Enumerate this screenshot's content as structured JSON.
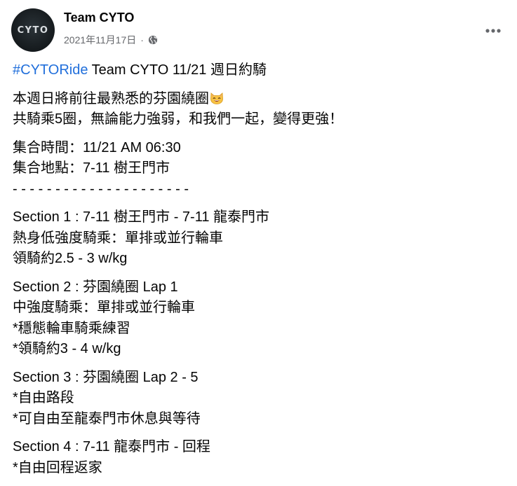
{
  "post": {
    "author": "Team CYTO",
    "avatar_text": "CYTO",
    "date": "2021年11月17日",
    "separator": "·",
    "privacy_icon": "globe-icon",
    "more_icon": "more-horizontal-icon"
  },
  "content": {
    "hashtag": "#CYTORide",
    "title_rest": " Team CYTO 11/21 週日約騎",
    "intro_line1": "本週日將前往最熟悉的芬園繞圈",
    "intro_emoji": "smiling-cat-face-emoji",
    "intro_line2": "共騎乘5圈，無論能力強弱，和我們一起，變得更強！",
    "meet_time": "集合時間：11/21 AM 06:30",
    "meet_place": "集合地點：7-11 樹王門市",
    "divider": "- - - - - - - - - - - - - - - - - - - - -",
    "sections": [
      {
        "title": "Section 1 : 7-11 樹王門市 - 7-11 龍泰門市",
        "lines": [
          "熱身低強度騎乘：單排或並行輪車",
          "領騎約2.5 - 3 w/kg"
        ]
      },
      {
        "title": "Section 2 : 芬園繞圈 Lap 1",
        "lines": [
          "中強度騎乘：單排或並行輪車",
          "*穩態輪車騎乘練習",
          "*領騎約3 - 4 w/kg"
        ]
      },
      {
        "title": "Section 3 : 芬園繞圈 Lap 2 - 5",
        "lines": [
          "*自由路段",
          "*可自由至龍泰門市休息與等待"
        ]
      },
      {
        "title": "Section 4 : 7-11 龍泰門市 - 回程",
        "lines": [
          "*自由回程返家"
        ]
      }
    ]
  }
}
